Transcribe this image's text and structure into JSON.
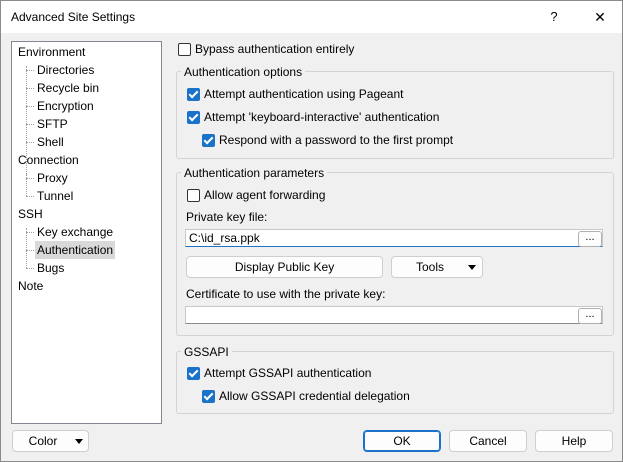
{
  "window": {
    "title": "Advanced Site Settings",
    "help_label": "?",
    "close_label": "✕"
  },
  "tree": {
    "environment": "Environment",
    "directories": "Directories",
    "recycle_bin": "Recycle bin",
    "encryption": "Encryption",
    "sftp": "SFTP",
    "shell": "Shell",
    "connection": "Connection",
    "proxy": "Proxy",
    "tunnel": "Tunnel",
    "ssh": "SSH",
    "key_exchange": "Key exchange",
    "authentication": "Authentication",
    "bugs": "Bugs",
    "note": "Note",
    "selected": "Authentication"
  },
  "bypass": {
    "label": "Bypass authentication entirely",
    "checked": false
  },
  "auth_options": {
    "title": "Authentication options",
    "pageant": {
      "label": "Attempt authentication using Pageant",
      "checked": true
    },
    "keyboard_interactive": {
      "label": "Attempt 'keyboard-interactive' authentication",
      "checked": true
    },
    "respond_password": {
      "label": "Respond with a password to the first prompt",
      "checked": true
    }
  },
  "auth_params": {
    "title": "Authentication parameters",
    "agent_forwarding": {
      "label": "Allow agent forwarding",
      "checked": false
    },
    "private_key_label": "Private key file:",
    "private_key_value": "C:\\id_rsa.ppk",
    "browse_label": "...",
    "display_public_key": "Display Public Key",
    "tools": "Tools",
    "certificate_label": "Certificate to use with the private key:",
    "certificate_value": "",
    "certificate_browse_label": "..."
  },
  "gssapi": {
    "title": "GSSAPI",
    "attempt": {
      "label": "Attempt GSSAPI authentication",
      "checked": true
    },
    "delegation": {
      "label": "Allow GSSAPI credential delegation",
      "checked": true
    }
  },
  "footer": {
    "color": "Color",
    "ok": "OK",
    "cancel": "Cancel",
    "help": "Help"
  }
}
